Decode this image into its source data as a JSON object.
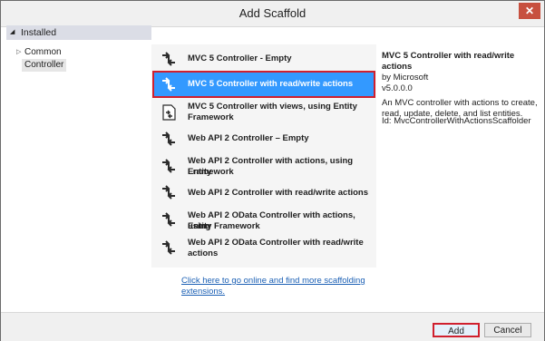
{
  "window": {
    "title": "Add Scaffold",
    "close_label": "✕"
  },
  "sidebar": {
    "header": "Installed",
    "items": [
      {
        "label": "Common",
        "expandable": true
      },
      {
        "label": "Controller",
        "selected": true
      }
    ]
  },
  "scaffolds": [
    {
      "label_lines": [
        "MVC 5 Controller - Empty"
      ],
      "icon": "controller-icon"
    },
    {
      "label_lines": [
        "MVC 5 Controller with read/write actions"
      ],
      "icon": "controller-icon",
      "selected": true
    },
    {
      "label_lines": [
        "MVC 5 Controller with views, using Entity",
        "Framework"
      ],
      "icon": "document-controller-icon"
    },
    {
      "label_lines": [
        "Web API 2 Controller – Empty"
      ],
      "icon": "controller-icon"
    },
    {
      "label_lines": [
        "Web API 2 Controller with actions, using Entity",
        "Framework"
      ],
      "icon": "controller-icon"
    },
    {
      "label_lines": [
        "Web API 2 Controller with read/write actions"
      ],
      "icon": "controller-icon"
    },
    {
      "label_lines": [
        "Web API 2 OData Controller with actions, using",
        "Entity Framework"
      ],
      "icon": "controller-icon"
    },
    {
      "label_lines": [
        "Web API 2 OData Controller with read/write",
        "actions"
      ],
      "icon": "controller-icon"
    }
  ],
  "online_link": {
    "lines": [
      "Click here to go online and find more scaffolding",
      "extensions."
    ]
  },
  "details": {
    "title": "MVC 5 Controller with read/write actions",
    "author": "by Microsoft",
    "version": "v5.0.0.0",
    "description_lines": [
      "An MVC controller with actions to create,",
      "read, update, delete, and list entities."
    ],
    "id_line": "Id: MvcControllerWithActionsScaffolder"
  },
  "buttons": {
    "add": "Add",
    "cancel": "Cancel"
  },
  "colors": {
    "selection": "#3399ff",
    "highlight_border": "#d0202e",
    "link": "#1a5fb4"
  }
}
